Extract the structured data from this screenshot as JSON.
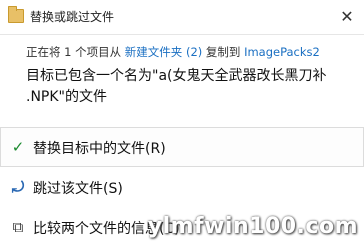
{
  "window": {
    "title": "替换或跳过文件",
    "close_glyph": "✕"
  },
  "status": {
    "prefix": "正在将 1 个项目从 ",
    "source": "新建文件夹 (2)",
    "middle": " 复制到 ",
    "destination": "ImagePacks2"
  },
  "description": {
    "line1": "目标已包含一个名为\"a(女鬼天全武器改长黑刀补",
    "line2": ".NPK\"的文件"
  },
  "options": [
    {
      "label": "替换目标中的文件(R)",
      "icon": "check-icon",
      "glyph": "✓"
    },
    {
      "label": "跳过该文件(S)",
      "icon": "skip-icon",
      "glyph": "⤾"
    },
    {
      "label": "比较两个文件的信息(C)",
      "icon": "compare-icon",
      "glyph": "⧉"
    }
  ],
  "watermark": "ylmfwin100.com"
}
